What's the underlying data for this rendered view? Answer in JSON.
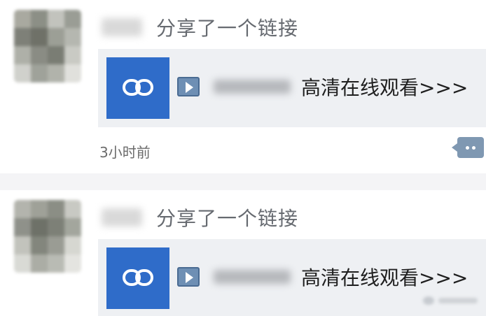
{
  "posts": [
    {
      "action_text": "分享了一个链接",
      "link_title": "高清在线观看>>>",
      "time": "3小时前"
    },
    {
      "action_text": "分享了一个链接",
      "link_title": "高清在线观看>>>"
    }
  ],
  "icons": {
    "link": "link-icon",
    "play": "play-icon",
    "comment": "comment-icon"
  },
  "colors": {
    "link_box": "#2f6cc9",
    "card_bg": "#eef0f3",
    "comment_button": "#7f98b2"
  }
}
